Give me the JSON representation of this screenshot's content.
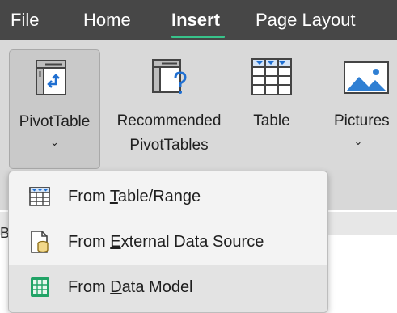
{
  "tabs": {
    "file": "File",
    "home": "Home",
    "insert": "Insert",
    "page_layout": "Page Layout"
  },
  "ribbon": {
    "pivot_table": {
      "label": "PivotTable",
      "chevron": "⌄"
    },
    "recommended": {
      "line1": "Recommended",
      "line2": "PivotTables"
    },
    "table": {
      "label": "Table"
    },
    "pictures": {
      "label": "Pictures",
      "chevron": "⌄"
    }
  },
  "behind": {
    "partial_letter": "B"
  },
  "menu": {
    "items": [
      {
        "pre": "From ",
        "key": "T",
        "post": "able/Range",
        "icon": "table-range-icon"
      },
      {
        "pre": "From ",
        "key": "E",
        "post": "xternal Data Source",
        "icon": "external-data-source-icon"
      },
      {
        "pre": "From ",
        "key": "D",
        "post": "ata Model",
        "icon": "data-model-icon"
      }
    ]
  },
  "colors": {
    "accent": "#38c48b",
    "tab_bar": "#474747",
    "ribbon": "#d9d9d9",
    "menu": "#f3f3f3"
  }
}
